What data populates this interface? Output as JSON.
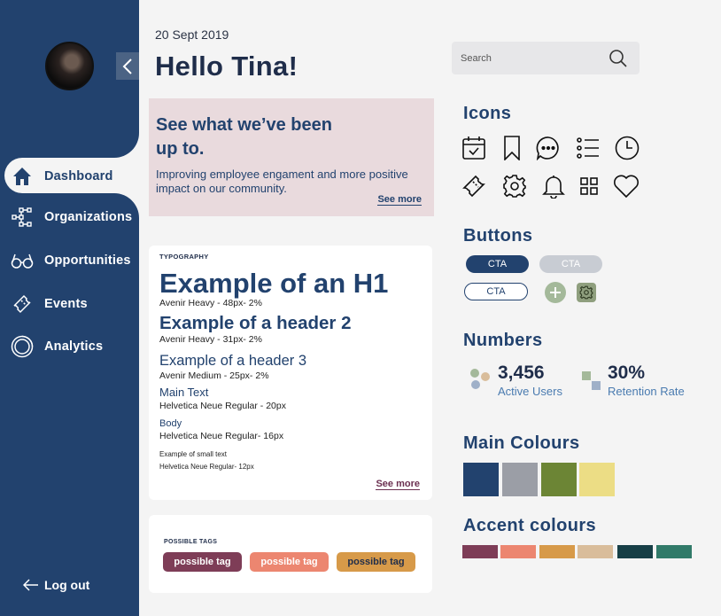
{
  "sidebar": {
    "nav": [
      {
        "label": "Dashboard",
        "icon": "home-icon"
      },
      {
        "label": "Organizations",
        "icon": "org-chart-icon"
      },
      {
        "label": "Opportunities",
        "icon": "glasses-icon"
      },
      {
        "label": "Events",
        "icon": "ticket-icon"
      },
      {
        "label": "Analytics",
        "icon": "analytics-icon"
      }
    ],
    "logout_label": "Log out"
  },
  "header": {
    "date": "20 Sept 2019",
    "greeting": "Hello Tina!"
  },
  "promo": {
    "title": "See what  we’ve been up to.",
    "text": "Improving employee engament and more positive impact on our community.",
    "link": "See more"
  },
  "typography": {
    "label": "TYPOGRAPHY",
    "h1": "Example of an H1",
    "h1_spec": "Avenir Heavy - 48px- 2%",
    "h2": "Example of a header 2",
    "h2_spec": "Avenir Heavy - 31px- 2%",
    "h3": "Example of a header 3",
    "h3_spec": "Avenir Medium - 25px- 2%",
    "main": "Main Text",
    "main_spec": "Helvetica Neue Regular - 20px",
    "body": "Body",
    "body_spec": "Helvetica Neue Regular- 16px",
    "small": "Example of small text",
    "small_spec": "Helvetica Neue Regular- 12px",
    "link": "See more"
  },
  "tags": {
    "label": "POSSIBLE TAGS",
    "items": [
      {
        "label": "possible tag",
        "color": "#7e3d57"
      },
      {
        "label": "possible tag",
        "color": "#ec8670"
      },
      {
        "label": "possible tag",
        "color": "#d79a49"
      }
    ]
  },
  "search": {
    "placeholder": "Search"
  },
  "icons": {
    "title": "Icons",
    "items": [
      "calendar-check-icon",
      "bookmark-icon",
      "chat-bubble-icon",
      "list-icon",
      "clock-icon",
      "ticket-icon",
      "gear-icon",
      "bell-icon",
      "grid-icon",
      "heart-icon"
    ]
  },
  "buttons": {
    "title": "Buttons",
    "primary": "CTA",
    "disabled": "CTA",
    "outline": "CTA",
    "colors": {
      "primary": "#22426e",
      "disabled": "#c8ccd3",
      "add": "#a4b99a",
      "settings": "#8f9f7e"
    }
  },
  "numbers": {
    "title": "Numbers",
    "stats": [
      {
        "value": "3,456",
        "label": "Active Users"
      },
      {
        "value": "30%",
        "label": "Retention Rate"
      }
    ]
  },
  "main_colours": {
    "title": "Main Colours",
    "swatches": [
      "#22426e",
      "#9b9ea6",
      "#6c8535",
      "#ecdd85"
    ]
  },
  "accent_colours": {
    "title": "Accent colours",
    "swatches": [
      "#7e3d57",
      "#ec8670",
      "#d79a49",
      "#d9bd9b",
      "#173f46",
      "#317a69"
    ]
  }
}
